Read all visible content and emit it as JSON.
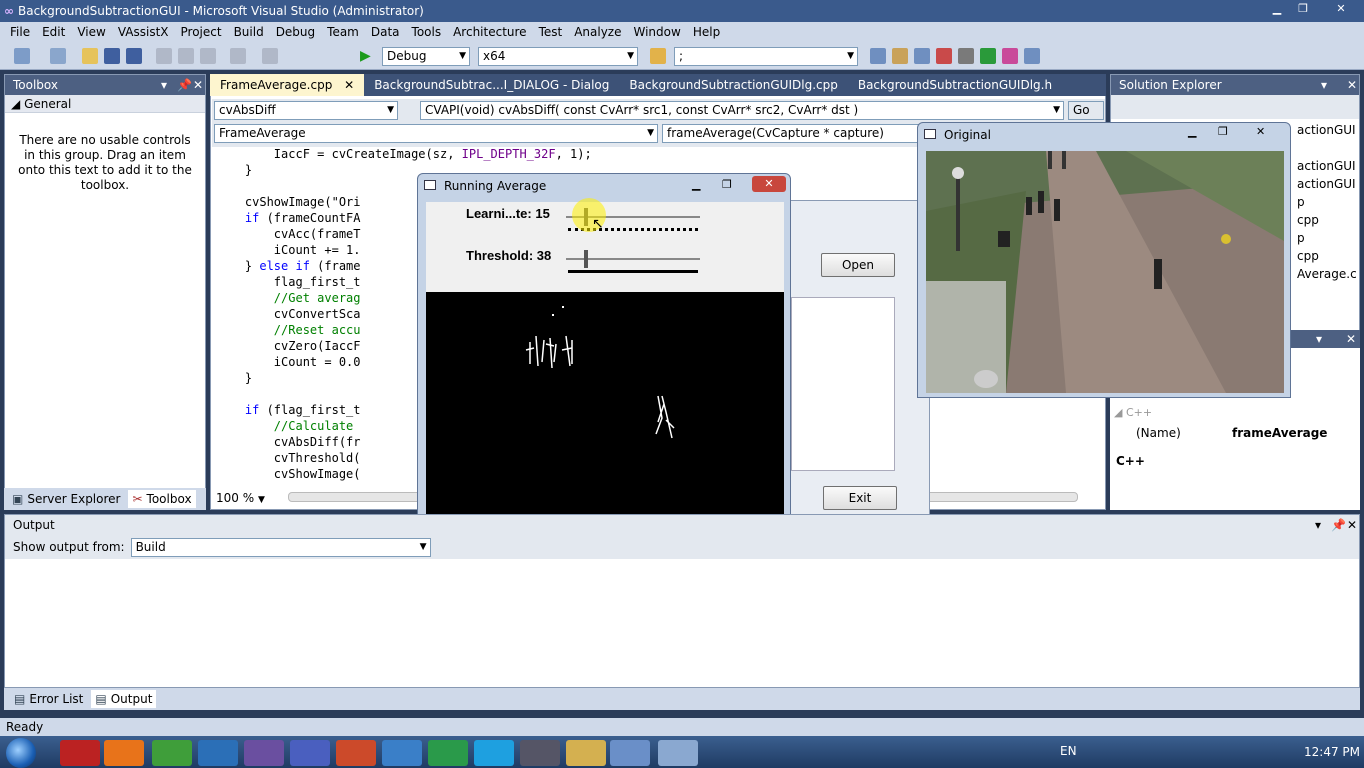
{
  "window": {
    "title": "BackgroundSubtractionGUI - Microsoft Visual Studio (Administrator)"
  },
  "menu": [
    "File",
    "Edit",
    "View",
    "VAssistX",
    "Project",
    "Build",
    "Debug",
    "Team",
    "Data",
    "Tools",
    "Architecture",
    "Test",
    "Analyze",
    "Window",
    "Help"
  ],
  "toolbar": {
    "config": "Debug",
    "platform": "x64",
    "find": ";"
  },
  "toolbox": {
    "title": "Toolbox",
    "group": "General",
    "message": "There are no usable controls in this group. Drag an item onto this text to add it to the toolbox.",
    "tabs": [
      "Server Explorer",
      "Toolbox"
    ]
  },
  "editor": {
    "tabs": [
      "FrameAverage.cpp",
      "BackgroundSubtrac...I_DIALOG - Dialog",
      "BackgroundSubtractionGUIDlg.cpp",
      "BackgroundSubtractionGUIDlg.h"
    ],
    "nav": {
      "function_combo": "cvAbsDiff",
      "signature": "CVAPI(void) cvAbsDiff( const CvArr* src1, const CvArr* src2, CvArr* dst )",
      "go": "Go",
      "scope": "FrameAverage",
      "member": "frameAverage(CvCapture * capture)"
    },
    "lines": [
      "        IaccF = cvCreateImage(sz, IPL_DEPTH_32F, 1);",
      "    }",
      "",
      "    cvShowImage(\"Ori",
      "    if (frameCountFA",
      "        cvAcc(frameT",
      "        iCount += 1.",
      "    } else if (frame",
      "        flag_first_t",
      "        //Get averag",
      "        cvConvertSca",
      "        //Reset accu",
      "        cvZero(IaccF",
      "        iCount = 0.0",
      "    }",
      "",
      "    if (flag_first_t",
      "        //Calculate",
      "        cvAbsDiff(fr",
      "        cvThreshold(",
      "        cvShowImage("
    ],
    "zoom": "100 %"
  },
  "solution_explorer": {
    "title": "Solution Explorer",
    "partial_items": [
      "actionGUI",
      "actionGUI",
      "actionGUI",
      "p",
      "cpp",
      "p",
      "cpp",
      "Average.c"
    ],
    "props": {
      "category": "C++",
      "name_label": "(Name)",
      "name_value": "frameAverage",
      "desc": "C++"
    }
  },
  "dialog": {
    "open": "Open",
    "exit": "Exit"
  },
  "running_average": {
    "title": "Running Average",
    "learning_label": "Learni...te: 15",
    "learning_value": 15,
    "threshold_label": "Threshold: 38",
    "threshold_value": 38
  },
  "original": {
    "title": "Original"
  },
  "output": {
    "title": "Output",
    "show_from_label": "Show output from:",
    "source": "Build",
    "tabs": [
      "Error List",
      "Output"
    ]
  },
  "status": "Ready",
  "taskbar": {
    "lang": "EN",
    "time": "12:47 PM"
  }
}
